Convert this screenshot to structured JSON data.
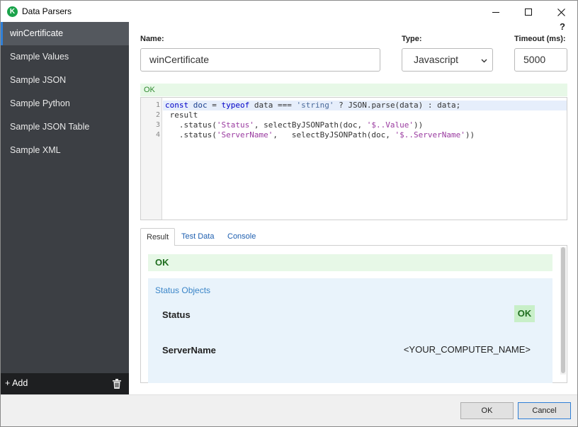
{
  "window": {
    "title": "Data Parsers",
    "app_icon_glyph": "K",
    "controls": {
      "minimize": "minimize-icon",
      "maximize": "maximize-icon",
      "close": "close-icon"
    }
  },
  "sidebar": {
    "items": [
      {
        "label": "winCertificate",
        "active": true
      },
      {
        "label": "Sample Values"
      },
      {
        "label": "Sample JSON"
      },
      {
        "label": "Sample Python"
      },
      {
        "label": "Sample JSON Table"
      },
      {
        "label": "Sample XML"
      }
    ],
    "add_label": "+ Add",
    "delete_icon": "trash-icon"
  },
  "help": {
    "label": "?"
  },
  "form": {
    "name_label": "Name:",
    "name_value": "winCertificate",
    "type_label": "Type:",
    "type_value": "Javascript",
    "timeout_label": "Timeout (ms):",
    "timeout_value": "5000"
  },
  "editor": {
    "status": "OK",
    "line_numbers": [
      "1",
      "2",
      "3",
      "4"
    ]
  },
  "tabs": [
    {
      "label": "Result",
      "active": true
    },
    {
      "label": "Test Data"
    },
    {
      "label": "Console"
    }
  ],
  "result": {
    "status": "OK",
    "section_title": "Status Objects",
    "rows": [
      {
        "label": "Status",
        "value": "OK"
      },
      {
        "label": "ServerName",
        "value": "<YOUR_COMPUTER_NAME>"
      }
    ]
  },
  "footer": {
    "ok_label": "OK",
    "cancel_label": "Cancel"
  },
  "colors": {
    "accent": "#2f7fd7",
    "sidebar_bg": "#3c3f44",
    "ok_green": "#e7f8e7"
  }
}
